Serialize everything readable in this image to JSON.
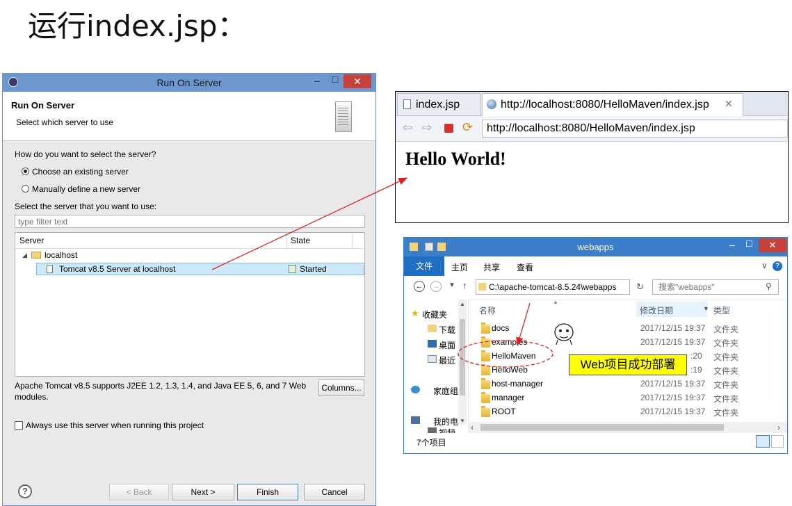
{
  "slide": {
    "title": "运行index.jsp："
  },
  "dialog": {
    "title": "Run On Server",
    "header_title": "Run On Server",
    "header_subtitle": "Select which server to use",
    "question": "How do you want to select the server?",
    "radio_existing": "Choose an existing server",
    "radio_manual": "Manually define a new server",
    "select_label": "Select the server that you want to use:",
    "filter_placeholder": "type filter text",
    "columns": {
      "server": "Server",
      "state": "State"
    },
    "tree": {
      "host": "localhost",
      "server_name": "Tomcat v8.5 Server at localhost",
      "server_state": "Started"
    },
    "description": "Apache Tomcat v8.5 supports J2EE 1.2, 1.3, 1.4, and Java EE 5, 6, and 7 Web modules.",
    "columns_button": "Columns...",
    "always_use": "Always use this server when running this project",
    "buttons": {
      "back": "< Back",
      "next": "Next >",
      "finish": "Finish",
      "cancel": "Cancel"
    }
  },
  "browser": {
    "tab1": "index.jsp",
    "tab2": "http://localhost:8080/HelloMaven/index.jsp",
    "url": "http://localhost:8080/HelloMaven/index.jsp",
    "content": "Hello World!"
  },
  "explorer": {
    "title": "webapps",
    "ribbon": {
      "file": "文件",
      "home": "主页",
      "share": "共享",
      "view": "查看"
    },
    "path": "C:\\apache-tomcat-8.5.24\\webapps",
    "search_placeholder": "搜索\"webapps\"",
    "columns": {
      "name": "名称",
      "date": "修改日期",
      "type": "类型"
    },
    "nav": [
      {
        "label": "收藏夹",
        "icon": "star-icon"
      },
      {
        "label": "下载",
        "icon": "download-folder-icon"
      },
      {
        "label": "桌面",
        "icon": "desktop-icon"
      },
      {
        "label": "最近",
        "icon": "recent-icon"
      },
      {
        "label": "家庭组",
        "icon": "homegroup-icon"
      },
      {
        "label": "我的电",
        "icon": "computer-icon"
      },
      {
        "label": "视频",
        "icon": "video-icon"
      }
    ],
    "files": [
      {
        "name": "docs",
        "date": "2017/12/15 19:37",
        "type": "文件夹"
      },
      {
        "name": "examples",
        "date": "2017/12/15 19:37",
        "type": "文件夹"
      },
      {
        "name": "HelloMaven",
        "date": ":20",
        "type": "文件夹"
      },
      {
        "name": "HelloWeb",
        "date": ":19",
        "type": "文件夹"
      },
      {
        "name": "host-manager",
        "date": "2017/12/15 19:37",
        "type": "文件夹"
      },
      {
        "name": "manager",
        "date": "2017/12/15 19:37",
        "type": "文件夹"
      },
      {
        "name": "ROOT",
        "date": "2017/12/15 19:37",
        "type": "文件夹"
      }
    ],
    "status": "7个项目"
  },
  "annotation": {
    "label": "Web项目成功部署"
  },
  "colors": {
    "titlebar": "#6d97cf",
    "close": "#c7413b",
    "selection": "#cde8f7",
    "annotation_bg": "#ffff00",
    "arrow": "#e02020"
  }
}
